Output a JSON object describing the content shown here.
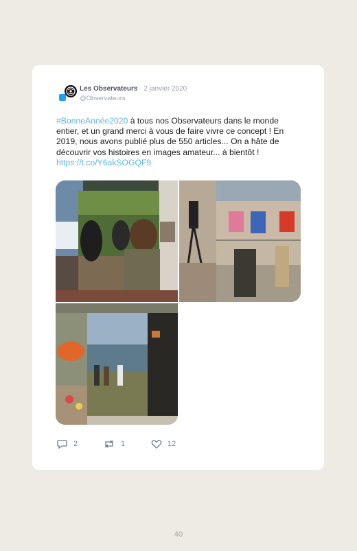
{
  "tweet": {
    "author_name": "Les Observateurs",
    "separator": " · ",
    "date": "2 janvier 2020",
    "handle": "@Observateurs",
    "hashtag": "#BonneAnnée2020",
    "body_text": " à tous nos Observateurs dans le monde entier, et un grand merci à vous de faire vivre ce concept ! En 2019, nous avons publié plus de 550 articles... On a hâte de découvrir vos histoires en images amateur... à bientôt ! ",
    "link": "https://t.co/Y6akSOGQF9"
  },
  "actions": {
    "replies": "2",
    "retweets": "1",
    "likes": "12"
  },
  "page_number": "40",
  "colors": {
    "background": "#eeebe4",
    "card": "#ffffff",
    "link": "#5fb4e4",
    "text": "#1c1c1c"
  },
  "icons": [
    "reply-icon",
    "retweet-icon",
    "like-icon"
  ]
}
